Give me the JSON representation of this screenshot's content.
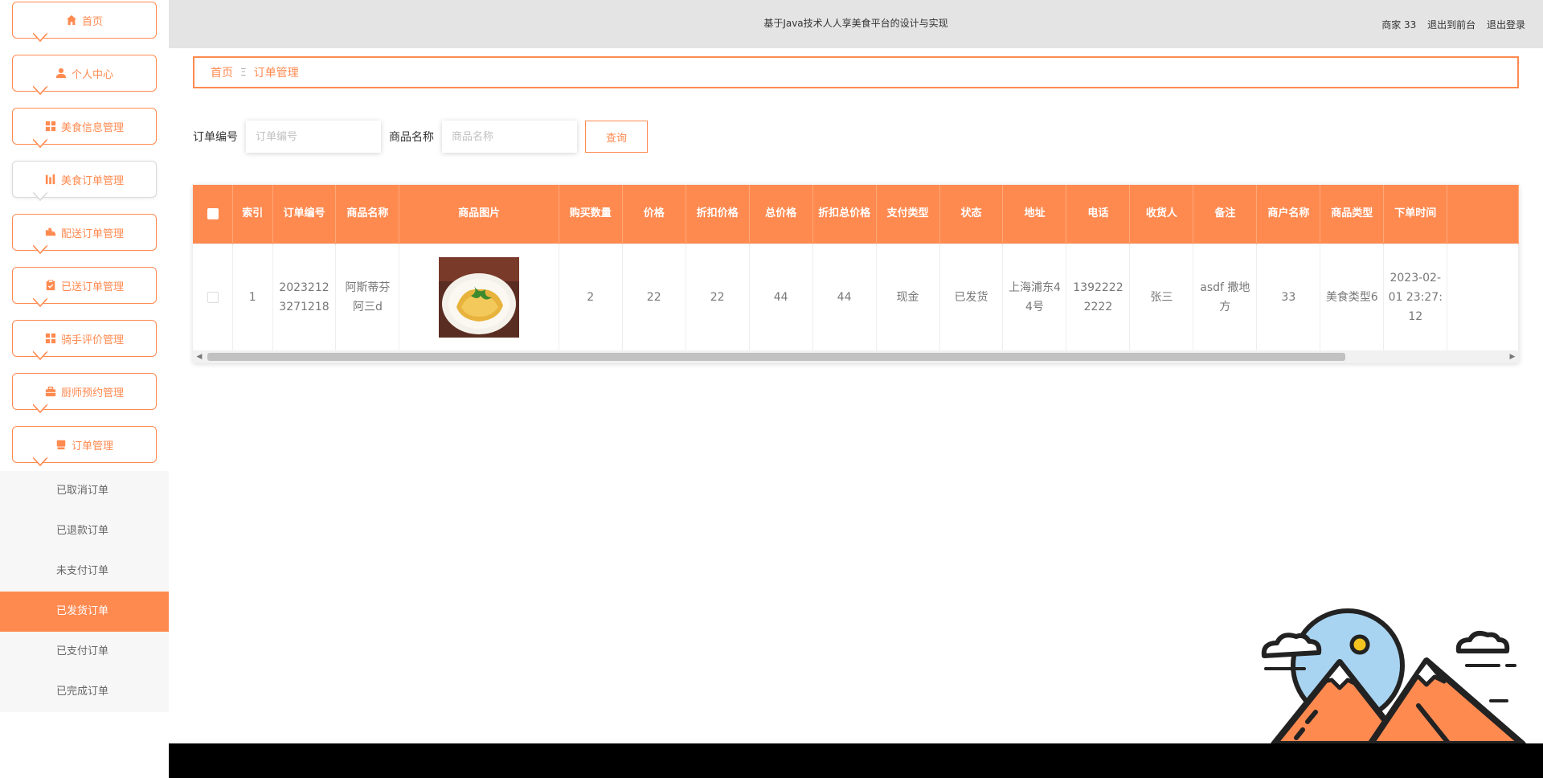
{
  "header": {
    "title": "基于Java技术人人享美食平台的设计与实现",
    "user_label": "商家 33",
    "to_front_label": "退出到前台",
    "logout_label": "退出登录"
  },
  "sidebar": {
    "items": [
      {
        "label": "首页",
        "icon": "home-icon"
      },
      {
        "label": "个人中心",
        "icon": "user-icon"
      },
      {
        "label": "美食信息管理",
        "icon": "grid-icon"
      },
      {
        "label": "美食订单管理",
        "icon": "chart-icon"
      },
      {
        "label": "配送订单管理",
        "icon": "truck-icon"
      },
      {
        "label": "已送订单管理",
        "icon": "clipboard-icon"
      },
      {
        "label": "骑手评价管理",
        "icon": "grid-icon"
      },
      {
        "label": "厨师预约管理",
        "icon": "briefcase-icon"
      },
      {
        "label": "订单管理",
        "icon": "cart-icon"
      }
    ],
    "submenu": [
      {
        "label": "已取消订单"
      },
      {
        "label": "已退款订单"
      },
      {
        "label": "未支付订单"
      },
      {
        "label": "已发货订单"
      },
      {
        "label": "已支付订单"
      },
      {
        "label": "已完成订单"
      }
    ]
  },
  "breadcrumb": {
    "home": "首页",
    "separator": "Ξ",
    "current": "订单管理"
  },
  "search": {
    "order_no_label": "订单编号",
    "order_no_placeholder": "订单编号",
    "order_no_value": "",
    "goods_name_label": "商品名称",
    "goods_name_placeholder": "商品名称",
    "goods_name_value": "",
    "query_label": "查询"
  },
  "table": {
    "columns": [
      "索引",
      "订单编号",
      "商品名称",
      "商品图片",
      "购买数量",
      "价格",
      "折扣价格",
      "总价格",
      "折扣总价格",
      "支付类型",
      "状态",
      "地址",
      "电话",
      "收货人",
      "备注",
      "商户名称",
      "商品类型",
      "下单时间"
    ],
    "rows": [
      {
        "index": "1",
        "order_no": "20232123271218",
        "goods_name": "阿斯蒂芬阿三d",
        "quantity": "2",
        "price": "22",
        "discount_price": "22",
        "total_price": "44",
        "discount_total": "44",
        "pay_type": "现金",
        "status": "已发货",
        "address": "上海浦东44号",
        "phone": "13922222222",
        "receiver": "张三",
        "remark": "asdf 撒地方",
        "merchant": "33",
        "goods_type": "美食类型6",
        "order_time": "2023-02-01 23:27:12"
      }
    ]
  },
  "colors": {
    "accent": "#ff8a50",
    "header_bg": "#e4e4e4",
    "footer_bg": "#000000"
  }
}
